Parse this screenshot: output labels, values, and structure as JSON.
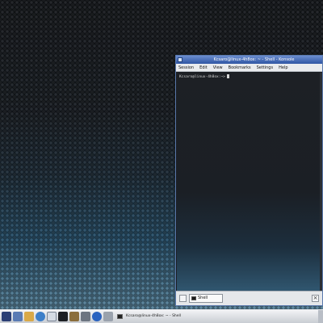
{
  "window": {
    "title": "Kcsaro@linux-4h8ox: ~ - Shell - Konsole",
    "menu": [
      "Session",
      "Edit",
      "View",
      "Bookmarks",
      "Settings",
      "Help"
    ],
    "prompt": "Kcsaro@linux-4h8ox:~>",
    "tab_label": "Shell",
    "tab_close": "×"
  },
  "taskbar": {
    "task_label": "Kcsaro@linux-4h8ox: ~ - Shell",
    "icons": [
      "kmenu-icon",
      "desktop-icon",
      "home-icon",
      "network-icon",
      "documents-icon",
      "terminal-icon",
      "office-icon",
      "media-player-icon",
      "konqueror-icon",
      "settings-icon"
    ]
  },
  "colors": {
    "titlebar": "#2f55a4",
    "desktop_light": "#5f8ba3",
    "desktop_dark": "#14171b"
  }
}
